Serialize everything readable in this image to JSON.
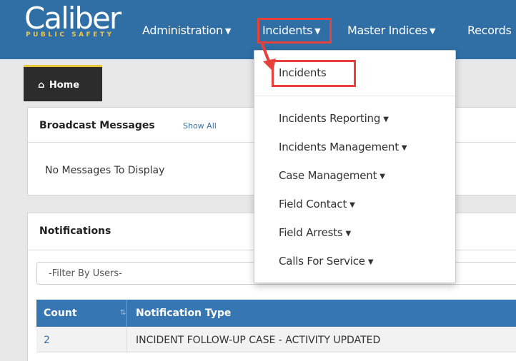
{
  "logo": {
    "main": "Caliber",
    "sub": "PUBLIC SAFETY"
  },
  "navbar": {
    "items": [
      {
        "label": "Administration"
      },
      {
        "label": "Incidents"
      },
      {
        "label": "Master Indices"
      },
      {
        "label": "Records"
      }
    ]
  },
  "home_tab": {
    "label": "Home"
  },
  "broadcast": {
    "title": "Broadcast Messages",
    "show_all": "Show All",
    "empty": "No Messages To Display"
  },
  "notifications": {
    "title": "Notifications",
    "filter_placeholder": "-Filter By Users-",
    "columns": [
      "Count",
      "Notification Type"
    ],
    "rows": [
      {
        "count": "2",
        "type": "INCIDENT FOLLOW-UP CASE - ACTIVITY UPDATED"
      }
    ]
  },
  "dropdown": {
    "top_item": "Incidents",
    "items": [
      {
        "label": "Incidents Reporting"
      },
      {
        "label": "Incidents Management"
      },
      {
        "label": "Case Management"
      },
      {
        "label": "Field Contact"
      },
      {
        "label": "Field Arrests"
      },
      {
        "label": "Calls For Service"
      }
    ]
  },
  "colors": {
    "navbar": "#2f6fa6",
    "highlight": "#e8403a",
    "table_header": "#3677b3",
    "home_tab_accent": "#e6c338"
  },
  "icons": {
    "home": "home-icon",
    "sort": "sort-icon",
    "caret": "caret-down-icon"
  }
}
